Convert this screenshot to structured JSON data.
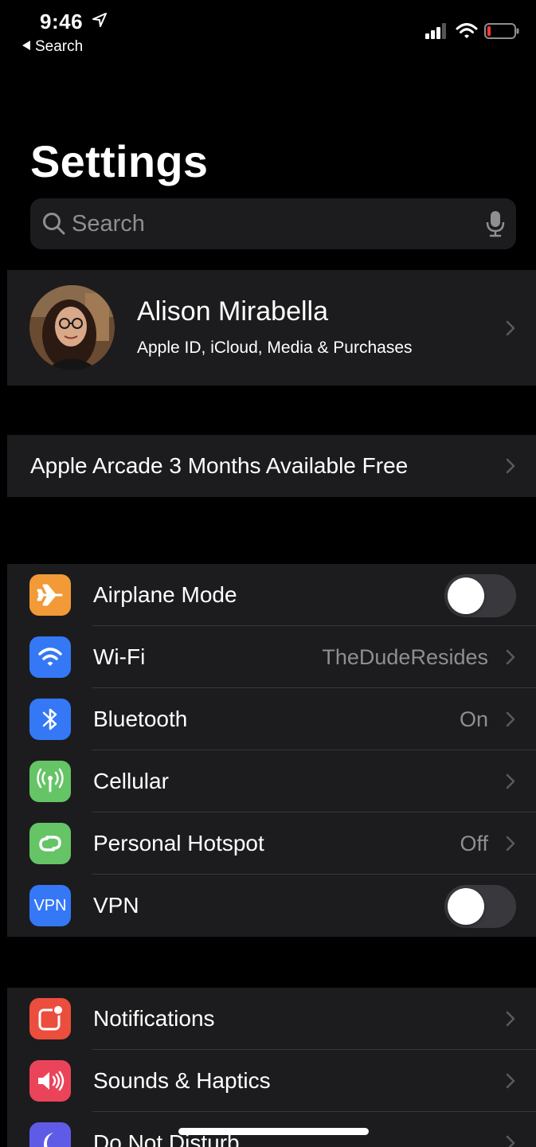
{
  "status_bar": {
    "time": "9:46",
    "back_label": "Search",
    "battery_color": "#ff3b30"
  },
  "header": {
    "title": "Settings"
  },
  "search": {
    "placeholder": "Search"
  },
  "profile": {
    "name": "Alison Mirabella",
    "subtitle": "Apple ID, iCloud, Media & Purchases"
  },
  "arcade": {
    "label": "Apple Arcade 3 Months Available Free"
  },
  "connectivity": [
    {
      "id": "airplane",
      "label": "Airplane Mode",
      "icon": "airplane-icon",
      "color": "#f19a37",
      "toggle": false
    },
    {
      "id": "wifi",
      "label": "Wi-Fi",
      "value": "TheDudeResides",
      "icon": "wifi-icon",
      "color": "#3478f6"
    },
    {
      "id": "bluetooth",
      "label": "Bluetooth",
      "value": "On",
      "icon": "bluetooth-icon",
      "color": "#3478f6"
    },
    {
      "id": "cellular",
      "label": "Cellular",
      "icon": "cellular-antenna-icon",
      "color": "#65c466"
    },
    {
      "id": "hotspot",
      "label": "Personal Hotspot",
      "value": "Off",
      "icon": "hotspot-icon",
      "color": "#65c466"
    },
    {
      "id": "vpn",
      "label": "VPN",
      "icon": "vpn-icon",
      "icon_text": "VPN",
      "color": "#3478f6",
      "toggle": false
    }
  ],
  "general": [
    {
      "id": "notifications",
      "label": "Notifications",
      "icon": "notifications-icon",
      "color": "#eb4e3d"
    },
    {
      "id": "sounds",
      "label": "Sounds & Haptics",
      "icon": "speaker-icon",
      "color": "#eb445a"
    },
    {
      "id": "dnd",
      "label": "Do Not Disturb",
      "icon": "moon-icon",
      "color": "#5e5ce6"
    }
  ]
}
